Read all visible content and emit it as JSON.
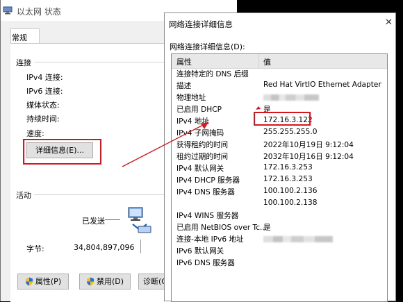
{
  "status_window": {
    "title": "以太网 状态",
    "tab_general": "常规",
    "connection_section": "连接",
    "connection_rows": [
      {
        "label": "IPv4 连接:"
      },
      {
        "label": "IPv6 连接:"
      },
      {
        "label": "媒体状态:"
      },
      {
        "label": "持续时间:"
      },
      {
        "label": "速度:"
      }
    ],
    "details_button": "详细信息(E)...",
    "activity_section": "活动",
    "sent_label": "已发送",
    "bytes_label": "字节:",
    "bytes_sent": "34,804,897,096",
    "properties_button": "属性(P)",
    "disable_button": "禁用(D)",
    "diagnose_button": "诊断(G)"
  },
  "details_dialog": {
    "title": "网络连接详细信息",
    "list_label": "网络连接详细信息(D):",
    "col_property": "属性",
    "col_value": "值",
    "rows": [
      {
        "prop": "连接特定的 DNS 后缀",
        "value": ""
      },
      {
        "prop": "描述",
        "value": "Red Hat VirtIO Ethernet Adapter"
      },
      {
        "prop": "物理地址",
        "value": "",
        "blurred": true
      },
      {
        "prop": "已启用 DHCP",
        "value": "是"
      },
      {
        "prop": "IPv4 地址",
        "value": "172.16.3.122"
      },
      {
        "prop": "IPv4 子网掩码",
        "value": "255.255.255.0"
      },
      {
        "prop": "获得租约的时间",
        "value": "2022年10月19日 9:12:04"
      },
      {
        "prop": "租约过期的时间",
        "value": "2032年10月16日 9:12:04"
      },
      {
        "prop": "IPv4 默认网关",
        "value": "172.16.3.253"
      },
      {
        "prop": "IPv4 DHCP 服务器",
        "value": "172.16.3.253"
      },
      {
        "prop": "IPv4 DNS 服务器",
        "value": "100.100.2.136"
      },
      {
        "prop": "",
        "value": "100.100.2.138"
      },
      {
        "prop": "IPv4 WINS 服务器",
        "value": ""
      },
      {
        "prop": "已启用 NetBIOS over Tc...",
        "value": "是"
      },
      {
        "prop": "连接-本地 IPv6 地址",
        "value": "",
        "blurred": true
      },
      {
        "prop": "IPv6 默认网关",
        "value": ""
      },
      {
        "prop": "IPv6 DNS 服务器",
        "value": ""
      }
    ]
  },
  "annotations": {
    "highlight_color": "#d9141c"
  }
}
